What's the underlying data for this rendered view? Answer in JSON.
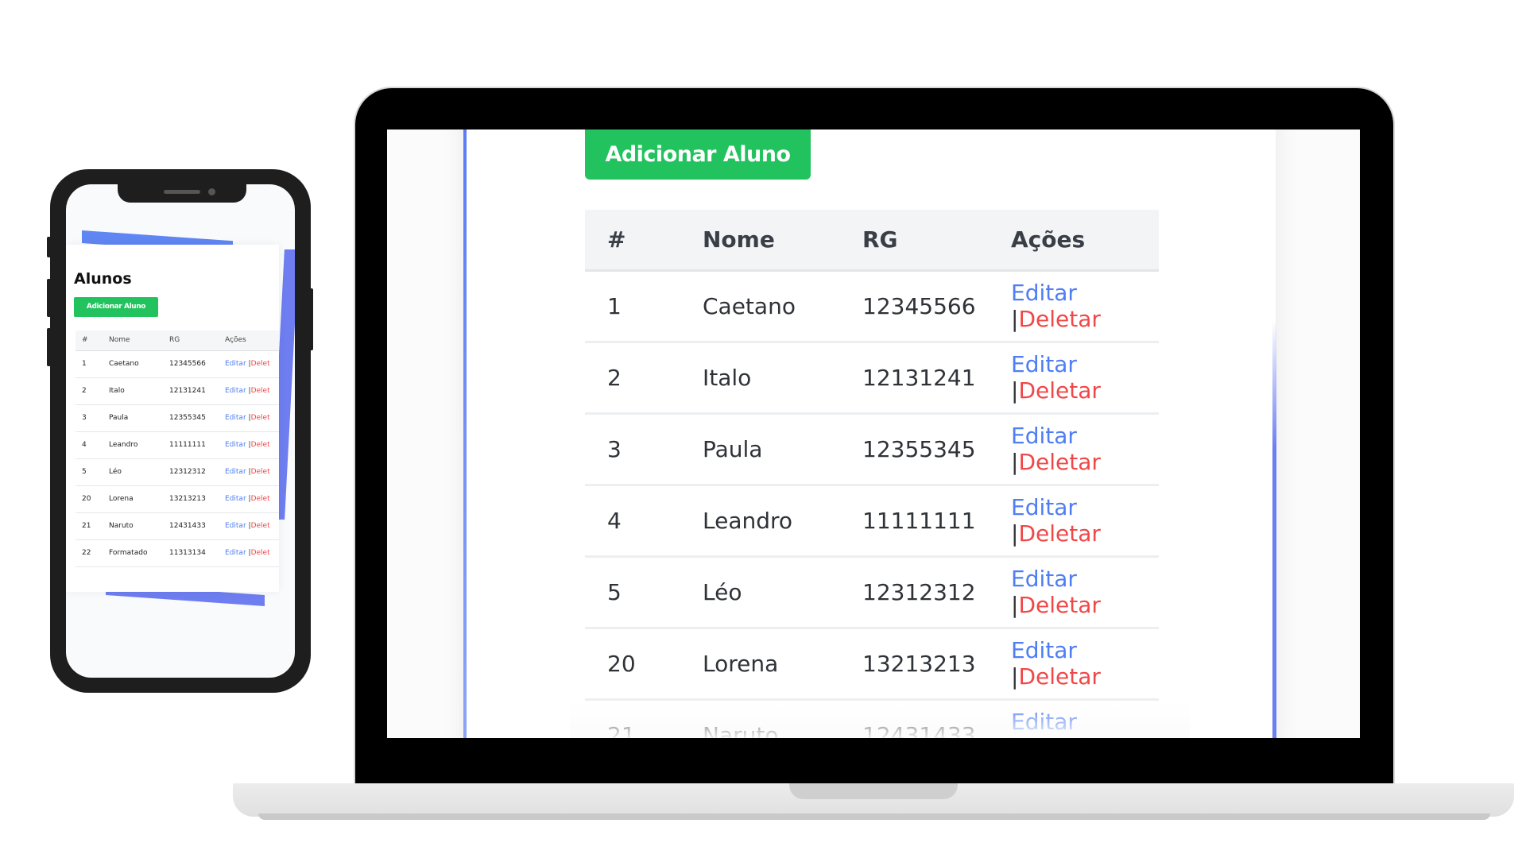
{
  "app": {
    "title": "Alunos",
    "add_button_label": "Adicionar Aluno"
  },
  "table": {
    "headers": {
      "num": "#",
      "name": "Nome",
      "rg": "RG",
      "actions": "Ações"
    },
    "rows": [
      {
        "num": "1",
        "name": "Caetano",
        "rg": "12345566"
      },
      {
        "num": "2",
        "name": "Italo",
        "rg": "12131241"
      },
      {
        "num": "3",
        "name": "Paula",
        "rg": "12355345"
      },
      {
        "num": "4",
        "name": "Leandro",
        "rg": "11111111"
      },
      {
        "num": "5",
        "name": "Léo",
        "rg": "12312312"
      },
      {
        "num": "20",
        "name": "Lorena",
        "rg": "13213213"
      },
      {
        "num": "21",
        "name": "Naruto",
        "rg": "12431433"
      },
      {
        "num": "22",
        "name": "Formatado",
        "rg": "11313134"
      }
    ],
    "action_edit": "Editar",
    "action_separator": "|",
    "action_delete": "Deletar",
    "action_delete_truncated": "Delet"
  },
  "colors": {
    "button_green": "#22c35e",
    "edit_link": "#4f7df3",
    "delete_link": "#f04848",
    "accent_blue": "#6c7ff0"
  }
}
